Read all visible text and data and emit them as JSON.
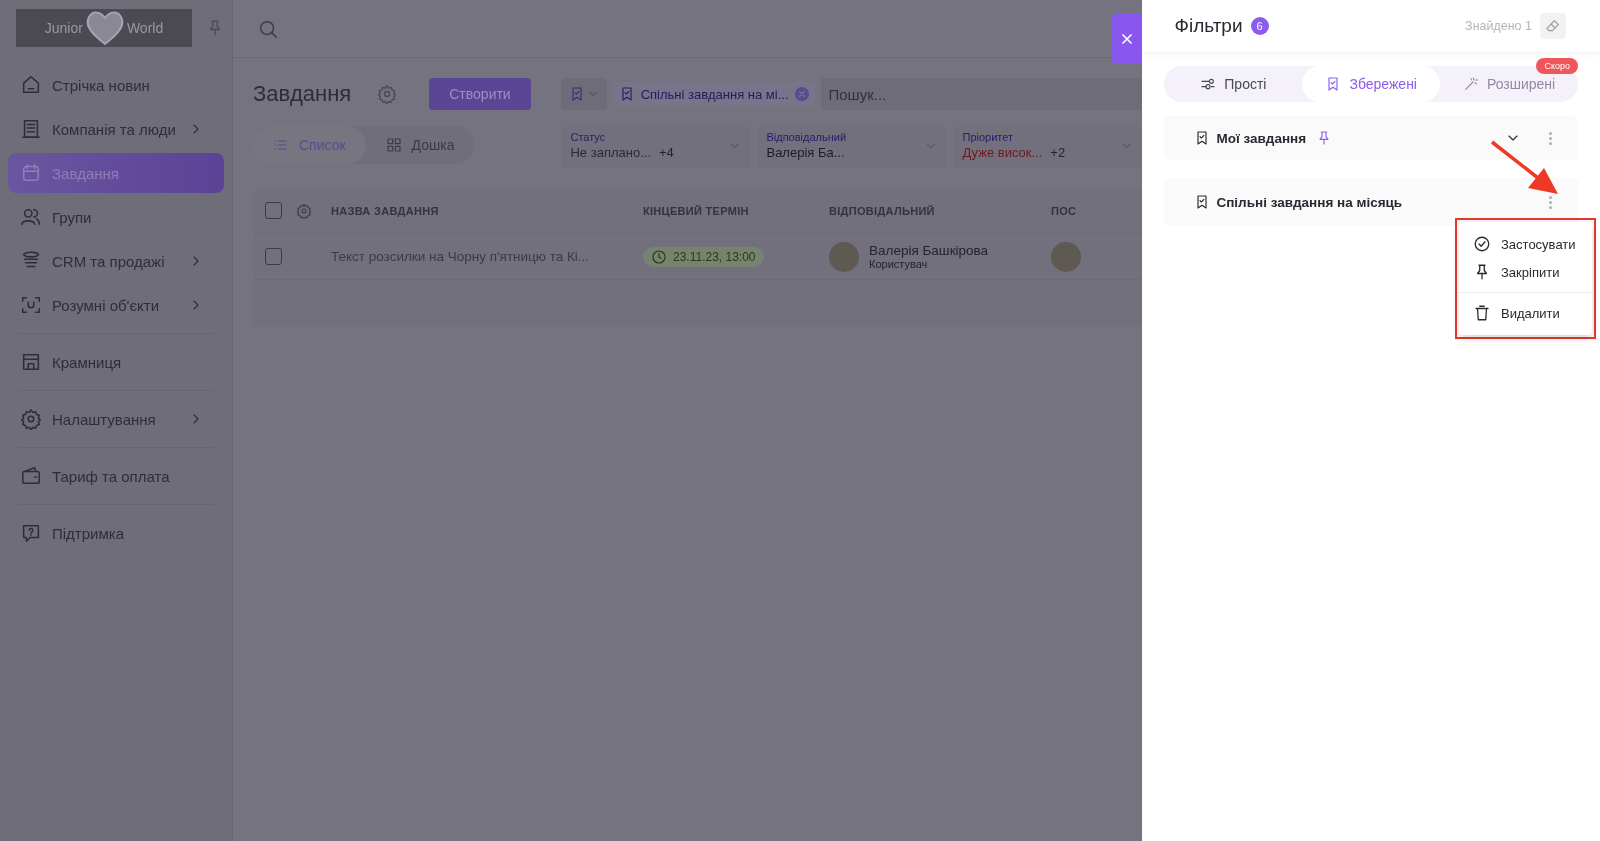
{
  "sidebar": {
    "logo": {
      "left": "Junior",
      "right": "World"
    },
    "items": [
      {
        "label": "Стрічка новин",
        "kind": "home",
        "submenu": false,
        "selected": false,
        "divider": false
      },
      {
        "label": "Компанія та люди",
        "kind": "building",
        "submenu": true,
        "selected": false,
        "divider": false
      },
      {
        "label": "Завдання",
        "kind": "calendar",
        "submenu": false,
        "selected": true,
        "divider": false
      },
      {
        "label": "Групи",
        "kind": "people",
        "submenu": false,
        "selected": false,
        "divider": false
      },
      {
        "label": "CRM та продажі",
        "kind": "layers",
        "submenu": true,
        "selected": false,
        "divider": false
      },
      {
        "label": "Розумні об'єкти",
        "kind": "scan",
        "submenu": true,
        "selected": false,
        "divider": true
      },
      {
        "label": "Крамниця",
        "kind": "store",
        "submenu": false,
        "selected": false,
        "divider": true
      },
      {
        "label": "Налаштування",
        "kind": "gear",
        "submenu": true,
        "selected": false,
        "divider": true
      },
      {
        "label": "Тариф та оплата",
        "kind": "wallet",
        "submenu": false,
        "selected": false,
        "divider": true
      },
      {
        "label": "Підтримка",
        "kind": "help",
        "submenu": false,
        "selected": false,
        "divider": false
      }
    ]
  },
  "main": {
    "title": "Завдання",
    "create_button": "Створити",
    "filter_chip": "Спільні завдання на мі...",
    "search": {
      "placeholder": "Пошук..."
    },
    "view_tabs": [
      {
        "label": "Список",
        "kind": "list",
        "selected": true
      },
      {
        "label": "Дошка",
        "kind": "grid",
        "selected": false
      }
    ],
    "filters": [
      {
        "label": "Статус",
        "value": "Не заплано...",
        "extra": "+4",
        "color": "#2c2a33"
      },
      {
        "label": "Відповідальний",
        "value": "Валерія Ба...",
        "color": "#1e1c25"
      },
      {
        "label": "Пріоритет",
        "value": "Дуже висок...",
        "extra": "+2",
        "color": "#6e1a22"
      }
    ],
    "table": {
      "columns": [
        "НАЗВА ЗАВДАННЯ",
        "КІНЦЕВИЙ ТЕРМІН",
        "ВІДПОВІДАЛЬНИЙ",
        "ПОС"
      ],
      "header_checked": false,
      "rows": [
        {
          "checked": false,
          "name": "Текст розсилки на Чорну п'ятницю та Кі...",
          "deadline": "23.11.23, 13:00",
          "assignee": "Валерія Башкірова",
          "role": "Користувач"
        }
      ]
    }
  },
  "panel": {
    "title": "Фільтри",
    "count": "6",
    "found": "Знайдено 1",
    "tabs": [
      {
        "label": "Прості",
        "kind": "sliders",
        "selected": false,
        "disabled": false
      },
      {
        "label": "Збережені",
        "kind": "bookmark",
        "selected": true,
        "disabled": false
      },
      {
        "label": "Розширені",
        "kind": "wand",
        "selected": false,
        "disabled": true,
        "badge": "Скоро"
      }
    ],
    "saved": [
      {
        "name": "Мої завдання",
        "pinned": true,
        "expandable": true,
        "menu_open": false
      },
      {
        "name": "Спільні завдання на місяць",
        "pinned": false,
        "expandable": false,
        "menu_open": true
      }
    ],
    "menu": [
      {
        "label": "Застосувати",
        "kind": "check",
        "divider": false
      },
      {
        "label": "Закріпити",
        "kind": "pin",
        "divider": false
      },
      {
        "label": "Видалити",
        "kind": "trash",
        "divider": true
      }
    ]
  }
}
